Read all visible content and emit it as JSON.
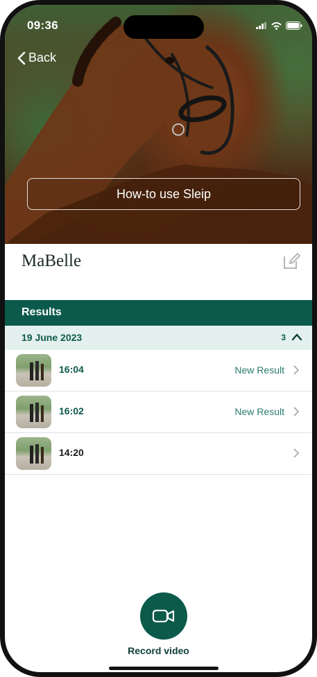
{
  "status_bar": {
    "time": "09:36"
  },
  "nav": {
    "back_label": "Back"
  },
  "hero": {
    "howto_label": "How-to use Sleip"
  },
  "horse": {
    "name": "MaBelle"
  },
  "results": {
    "header": "Results",
    "group": {
      "date": "19 June 2023",
      "count": "3"
    },
    "rows": [
      {
        "time": "16:04",
        "status": "New Result"
      },
      {
        "time": "16:02",
        "status": "New Result"
      },
      {
        "time": "14:20",
        "status": ""
      }
    ]
  },
  "record": {
    "label": "Record video"
  },
  "colors": {
    "accent": "#0c5a4b",
    "accent_light": "#e3f0ee"
  }
}
